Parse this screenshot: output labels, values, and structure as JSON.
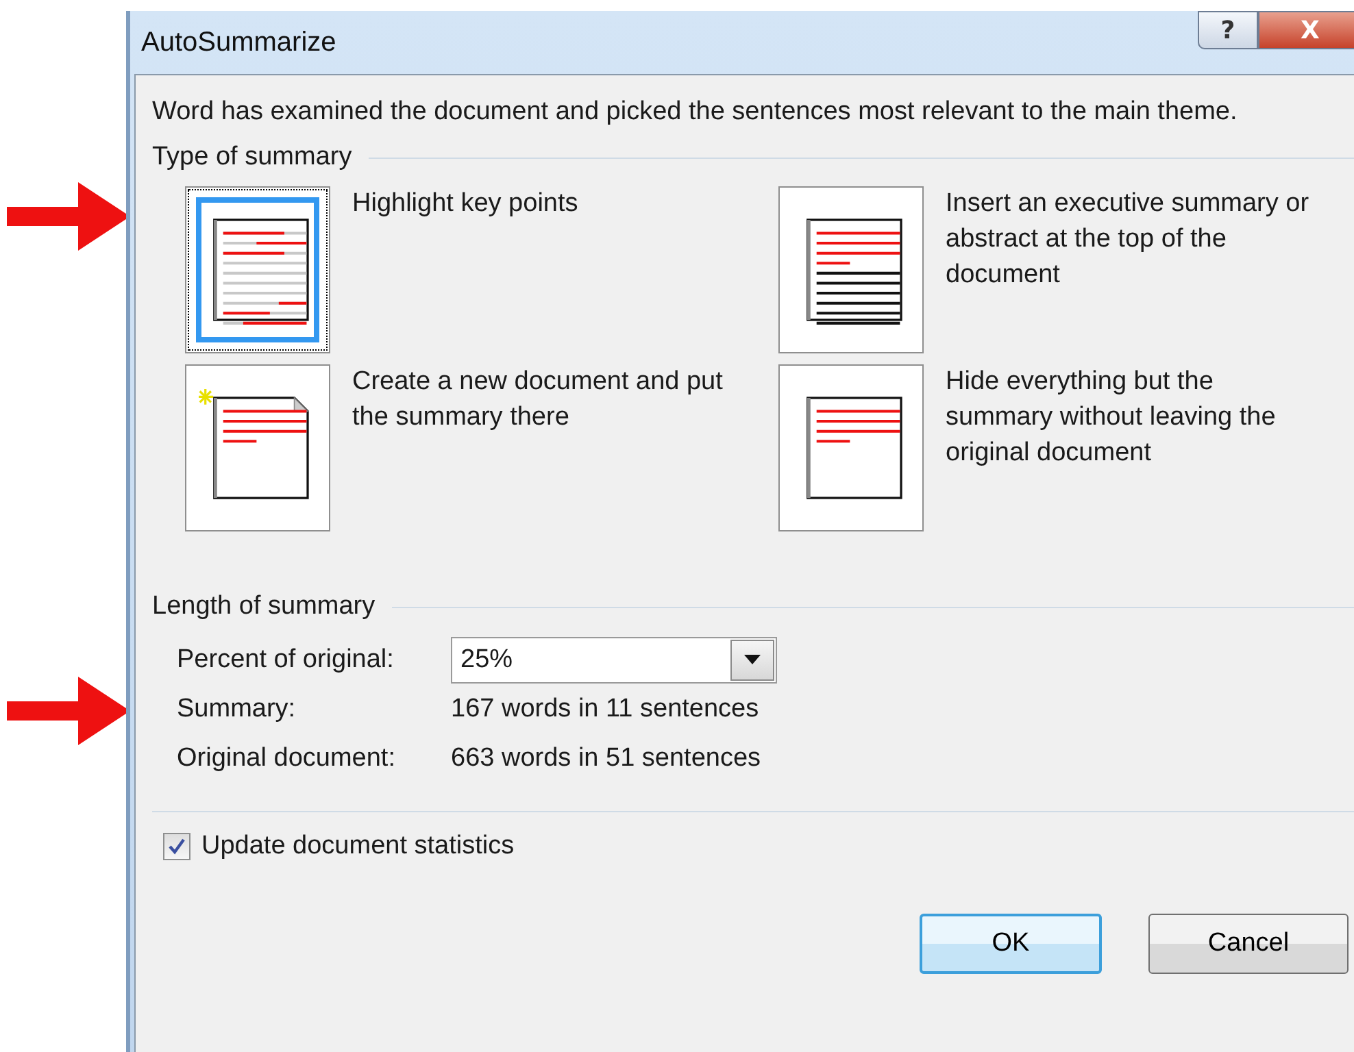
{
  "window": {
    "title": "AutoSummarize",
    "help_button": "?",
    "close_button": "X"
  },
  "intro": "Word has examined the document and picked the sentences most relevant to the main theme.",
  "type_section": {
    "title": "Type of summary",
    "options": [
      {
        "kind": "highlight",
        "label": "Highlight key points",
        "selected": true
      },
      {
        "kind": "executive",
        "label": "Insert an executive summary or abstract at the top of the document",
        "selected": false
      },
      {
        "kind": "new_document",
        "label": "Create a new document and put the summary there",
        "selected": false
      },
      {
        "kind": "hide",
        "label": "Hide everything but the summary without leaving the original document",
        "selected": false
      }
    ]
  },
  "length_section": {
    "title": "Length of summary",
    "percent_label": "Percent of original:",
    "percent_value": "25%",
    "stats": [
      {
        "label": "Summary:",
        "value": "167 words in 11 sentences"
      },
      {
        "label": "Original document:",
        "value": "663 words in 51 sentences"
      }
    ]
  },
  "update_statistics": {
    "label": "Update document statistics",
    "checked": true
  },
  "buttons": [
    {
      "label": "OK",
      "default": true
    },
    {
      "label": "Cancel",
      "default": false
    }
  ]
}
